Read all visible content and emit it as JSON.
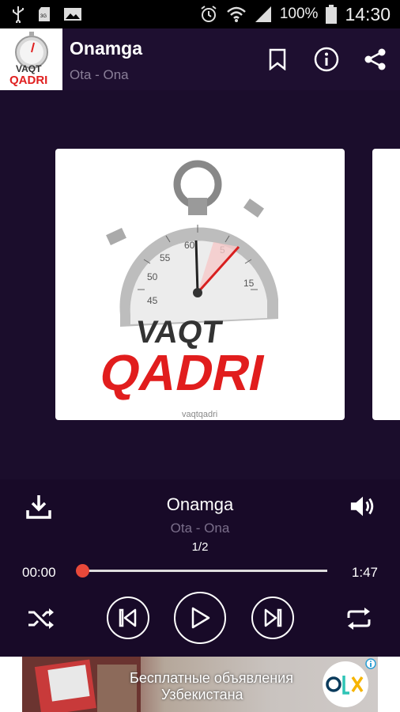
{
  "status_bar": {
    "battery_percent": "100%",
    "time": "14:30",
    "icons": [
      "usb-icon",
      "sd-card-icon",
      "image-icon",
      "alarm-icon",
      "wifi-icon",
      "signal-icon",
      "battery-icon"
    ]
  },
  "header": {
    "title": "Onamga",
    "subtitle": "Ota - Ona",
    "actions": [
      "bookmark-icon",
      "info-icon",
      "share-icon"
    ]
  },
  "artwork": {
    "line1": "VAQT",
    "line2": "QADRI",
    "watermark": "vaqtqadri",
    "dial_numbers": [
      "55",
      "60",
      "5",
      "50",
      "15",
      "45"
    ]
  },
  "player": {
    "title": "Onamga",
    "subtitle": "Ota - Ona",
    "track_count": "1/2",
    "current_time": "00:00",
    "duration": "1:47",
    "progress": 0
  },
  "ad": {
    "line1": "Бесплатные объявления",
    "line2": "Узбекистана",
    "logo_text": "OLX"
  },
  "colors": {
    "header_bg": "#1e0f30",
    "art_bg": "#1b0d2c",
    "player_bg": "#180a28",
    "accent": "#e8493a",
    "subtitle": "#8a7f98"
  }
}
